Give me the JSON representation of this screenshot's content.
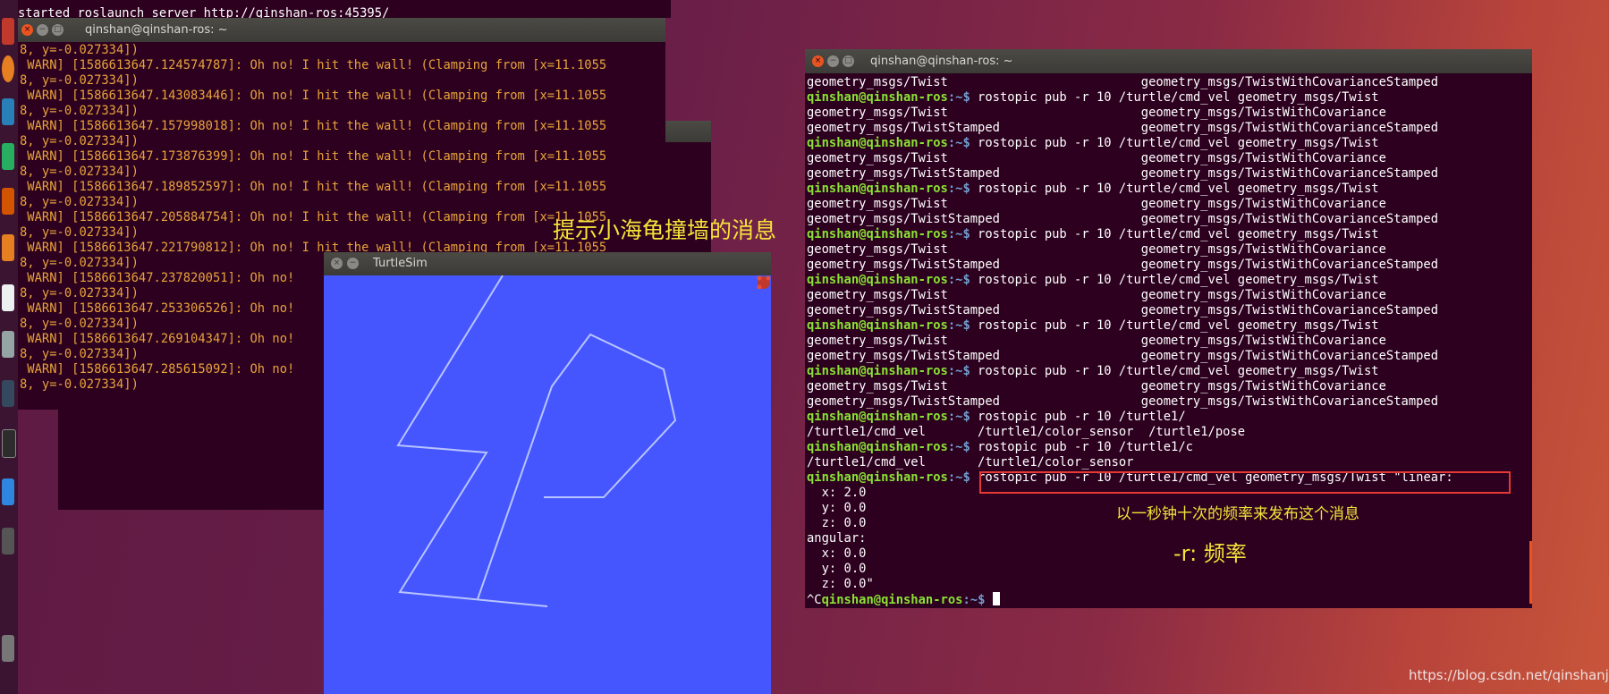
{
  "top_line": "started roslaunch server http://qinshan-ros:45395/",
  "left_terminal": {
    "title": "qinshan@qinshan-ros: ~",
    "lines": [
      {
        "cls": "warn",
        "text": "8, y=-0.027334])"
      },
      {
        "cls": "warn",
        "text": " WARN] [1586613647.124574787]: Oh no! I hit the wall! (Clamping from [x=11.1055"
      },
      {
        "cls": "warn",
        "text": "8, y=-0.027334])"
      },
      {
        "cls": "warn",
        "text": " WARN] [1586613647.143083446]: Oh no! I hit the wall! (Clamping from [x=11.1055"
      },
      {
        "cls": "warn",
        "text": "8, y=-0.027334])"
      },
      {
        "cls": "warn",
        "text": " WARN] [1586613647.157998018]: Oh no! I hit the wall! (Clamping from [x=11.1055"
      },
      {
        "cls": "warn",
        "text": "8, y=-0.027334])"
      },
      {
        "cls": "warn",
        "text": " WARN] [1586613647.173876399]: Oh no! I hit the wall! (Clamping from [x=11.1055"
      },
      {
        "cls": "warn",
        "text": "8, y=-0.027334])"
      },
      {
        "cls": "warn",
        "text": " WARN] [1586613647.189852597]: Oh no! I hit the wall! (Clamping from [x=11.1055"
      },
      {
        "cls": "warn",
        "text": "8, y=-0.027334])"
      },
      {
        "cls": "warn",
        "text": " WARN] [1586613647.205884754]: Oh no! I hit the wall! (Clamping from [x=11.1055"
      },
      {
        "cls": "warn",
        "text": "8, y=-0.027334])"
      },
      {
        "cls": "warn",
        "text": " WARN] [1586613647.221790812]: Oh no! I hit the wall! (Clamping from [x=11.1055"
      },
      {
        "cls": "warn",
        "text": "8, y=-0.027334])"
      },
      {
        "cls": "warn",
        "text": " WARN] [1586613647.237820051]: Oh no!"
      },
      {
        "cls": "warn",
        "text": "8, y=-0.027334])"
      },
      {
        "cls": "warn",
        "text": " WARN] [1586613647.253306526]: Oh no!"
      },
      {
        "cls": "warn",
        "text": "8, y=-0.027334])"
      },
      {
        "cls": "warn",
        "text": " WARN] [1586613647.269104347]: Oh no!"
      },
      {
        "cls": "warn",
        "text": "8, y=-0.027334])"
      },
      {
        "cls": "warn",
        "text": " WARN] [1586613647.285615092]: Oh no!"
      },
      {
        "cls": "warn",
        "text": "8, y=-0.027334])"
      }
    ]
  },
  "turtlesim": {
    "title": "TurtleSim",
    "background": "#4556ff",
    "line_color": "#b8c4ff"
  },
  "right_terminal": {
    "title": "qinshan@qinshan-ros: ~",
    "prompt_user": "qinshan@qinshan-ros",
    "prompt_path": ":~$",
    "lines": [
      {
        "kind": "out",
        "text": "geometry_msgs/Twist                          geometry_msgs/TwistWithCovarianceStamped"
      },
      {
        "kind": "cmd",
        "text": " rostopic pub -r 10 /turtle/cmd_vel geometry_msgs/Twist"
      },
      {
        "kind": "out",
        "text": "geometry_msgs/Twist                          geometry_msgs/TwistWithCovariance"
      },
      {
        "kind": "out",
        "text": "geometry_msgs/TwistStamped                   geometry_msgs/TwistWithCovarianceStamped"
      },
      {
        "kind": "cmd",
        "text": " rostopic pub -r 10 /turtle/cmd_vel geometry_msgs/Twist"
      },
      {
        "kind": "out",
        "text": "geometry_msgs/Twist                          geometry_msgs/TwistWithCovariance"
      },
      {
        "kind": "out",
        "text": "geometry_msgs/TwistStamped                   geometry_msgs/TwistWithCovarianceStamped"
      },
      {
        "kind": "cmd",
        "text": " rostopic pub -r 10 /turtle/cmd_vel geometry_msgs/Twist"
      },
      {
        "kind": "out",
        "text": "geometry_msgs/Twist                          geometry_msgs/TwistWithCovariance"
      },
      {
        "kind": "out",
        "text": "geometry_msgs/TwistStamped                   geometry_msgs/TwistWithCovarianceStamped"
      },
      {
        "kind": "cmd",
        "text": " rostopic pub -r 10 /turtle/cmd_vel geometry_msgs/Twist"
      },
      {
        "kind": "out",
        "text": "geometry_msgs/Twist                          geometry_msgs/TwistWithCovariance"
      },
      {
        "kind": "out",
        "text": "geometry_msgs/TwistStamped                   geometry_msgs/TwistWithCovarianceStamped"
      },
      {
        "kind": "cmd",
        "text": " rostopic pub -r 10 /turtle/cmd_vel geometry_msgs/Twist"
      },
      {
        "kind": "out",
        "text": "geometry_msgs/Twist                          geometry_msgs/TwistWithCovariance"
      },
      {
        "kind": "out",
        "text": "geometry_msgs/TwistStamped                   geometry_msgs/TwistWithCovarianceStamped"
      },
      {
        "kind": "cmd",
        "text": " rostopic pub -r 10 /turtle/cmd_vel geometry_msgs/Twist"
      },
      {
        "kind": "out",
        "text": "geometry_msgs/Twist                          geometry_msgs/TwistWithCovariance"
      },
      {
        "kind": "out",
        "text": "geometry_msgs/TwistStamped                   geometry_msgs/TwistWithCovarianceStamped"
      },
      {
        "kind": "cmd",
        "text": " rostopic pub -r 10 /turtle/cmd_vel geometry_msgs/Twist"
      },
      {
        "kind": "out",
        "text": "geometry_msgs/Twist                          geometry_msgs/TwistWithCovariance"
      },
      {
        "kind": "out",
        "text": "geometry_msgs/TwistStamped                   geometry_msgs/TwistWithCovarianceStamped"
      },
      {
        "kind": "cmd",
        "text": " rostopic pub -r 10 /turtle1/"
      },
      {
        "kind": "out",
        "text": "/turtle1/cmd_vel       /turtle1/color_sensor  /turtle1/pose"
      },
      {
        "kind": "cmd",
        "text": " rostopic pub -r 10 /turtle1/c"
      },
      {
        "kind": "out",
        "text": "/turtle1/cmd_vel       /turtle1/color_sensor"
      },
      {
        "kind": "cmd",
        "text": " rostopic pub -r 10 /turtle1/cmd_vel geometry_msgs/Twist \"linear:"
      },
      {
        "kind": "out",
        "text": "  x: 2.0"
      },
      {
        "kind": "out",
        "text": "  y: 0.0"
      },
      {
        "kind": "out",
        "text": "  z: 0.0"
      },
      {
        "kind": "out",
        "text": "angular:"
      },
      {
        "kind": "out",
        "text": "  x: 0.0"
      },
      {
        "kind": "out",
        "text": "  y: 0.0"
      },
      {
        "kind": "out",
        "text": "  z: 0.0\""
      },
      {
        "kind": "last",
        "text": "^C"
      }
    ]
  },
  "annotations": {
    "wall_message": "提示小海龟撞墙的消息",
    "rate_desc": "以一秒钟十次的频率来发布这个消息",
    "rate_flag": "-r: 频率",
    "highlight_color": "#e53935"
  },
  "watermark": "https://blog.csdn.net/qinshanjy"
}
